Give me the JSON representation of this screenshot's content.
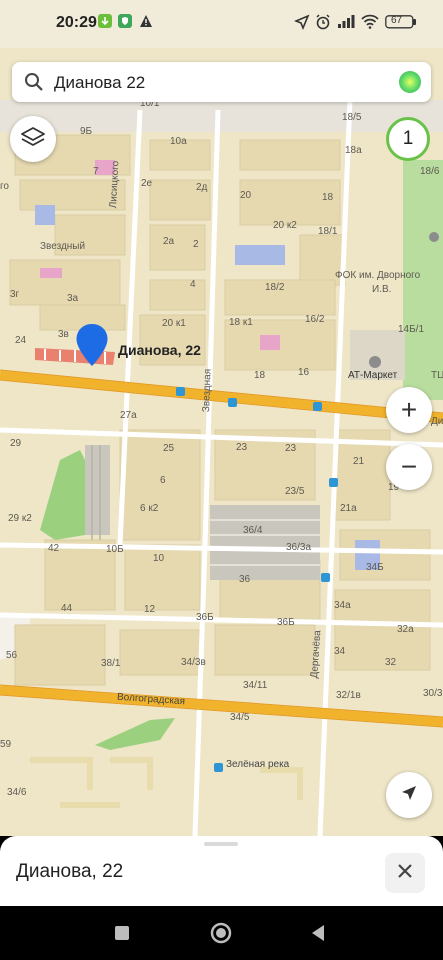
{
  "status_bar": {
    "time": "20:29",
    "battery": "67",
    "icons": [
      "download-icon",
      "shield-icon",
      "warning-icon",
      "location-arrow-icon",
      "alarm-icon",
      "signal-icon",
      "wifi-icon",
      "battery-icon"
    ]
  },
  "search": {
    "query": "Дианова 22",
    "icon": "search-icon",
    "assistant_icon": "alice-icon"
  },
  "controls": {
    "layers_icon": "layers-icon",
    "speed_badge": "1",
    "zoom_in": "+",
    "zoom_out": "−",
    "locate_icon": "navigation-arrow-icon"
  },
  "marker": {
    "label": "Дианова, 22",
    "color": "#1e6be6"
  },
  "map_labels": {
    "l_10_1": "10/1",
    "l_9b": "9Б",
    "l_10a": "10а",
    "l_18_5": "18/5",
    "l_18a": "18а",
    "l_18_6": "18/6",
    "l_7": "7",
    "l_2e": "2е",
    "l_2d": "2д",
    "l_20": "20",
    "l_18": "18",
    "l_20k2": "20 к2",
    "l_18_1": "18/1",
    "l_zvezdny": "Звездный",
    "l_2a": "2а",
    "l_2": "2",
    "l_fok": "ФОК им. Дворного",
    "l_iv": "И.В.",
    "l_18_2": "18/2",
    "l_3g": "3г",
    "l_4": "4",
    "l_3a": "3а",
    "l_16_2": "16/2",
    "l_14b1": "14Б/1",
    "l_3v": "3в",
    "l_20k1": "20 к1",
    "l_18k1": "18 к1",
    "l_24": "24",
    "l_at": "АТ-Маркет",
    "l_16": "16",
    "l_18b": "18",
    "l_27a": "27а",
    "l_29": "29",
    "l_25": "25",
    "l_23a": "23",
    "l_23b": "23",
    "l_21": "21",
    "l_23_5": "23/5",
    "l_6": "6",
    "l_6k2": "6 к2",
    "l_21a": "21а",
    "l_29k2": "29 к2",
    "l_36_4": "36/4",
    "l_36_3a": "36/3а",
    "l_42": "42",
    "l_10b": "10Б",
    "l_10": "10",
    "l_34b": "34Б",
    "l_36": "36",
    "l_44": "44",
    "l_12": "12",
    "l_34a": "34а",
    "l_36b": "36Б",
    "l_32a": "32а",
    "l_36b2": "36Б",
    "l_56": "56",
    "l_38_1": "38/1",
    "l_34_3v": "34/3в",
    "l_34": "34",
    "l_32": "32",
    "l_34_11": "34/11",
    "l_32_1v": "32/1в",
    "l_30": "30/3",
    "l_34_5": "34/5",
    "l_59": "59",
    "l_34_6": "34/6",
    "l_19": "19",
    "l_green": "Зелёная река",
    "street_lisitskogo": "Лисицкого",
    "street_zvezdnaya": "Звездная",
    "street_dergacheva": "Дергачёва",
    "street_volgogradskaya": "Волгоградская",
    "l_edge_go": "го",
    "l_tu": "ТЦ",
    "l_dia": "Диа"
  },
  "bottom_sheet": {
    "title": "Дианова, 22",
    "close_icon": "close-icon"
  },
  "nav_bar": {
    "recent_icon": "square-icon",
    "home_icon": "circle-icon",
    "back_icon": "back-triangle-icon"
  },
  "colors": {
    "road": "#f0b32b",
    "land": "#efe6c8",
    "building": "#e7dcb7",
    "park": "#9bd07f",
    "marker": "#1e6be6",
    "highlight": "#e9816e"
  }
}
